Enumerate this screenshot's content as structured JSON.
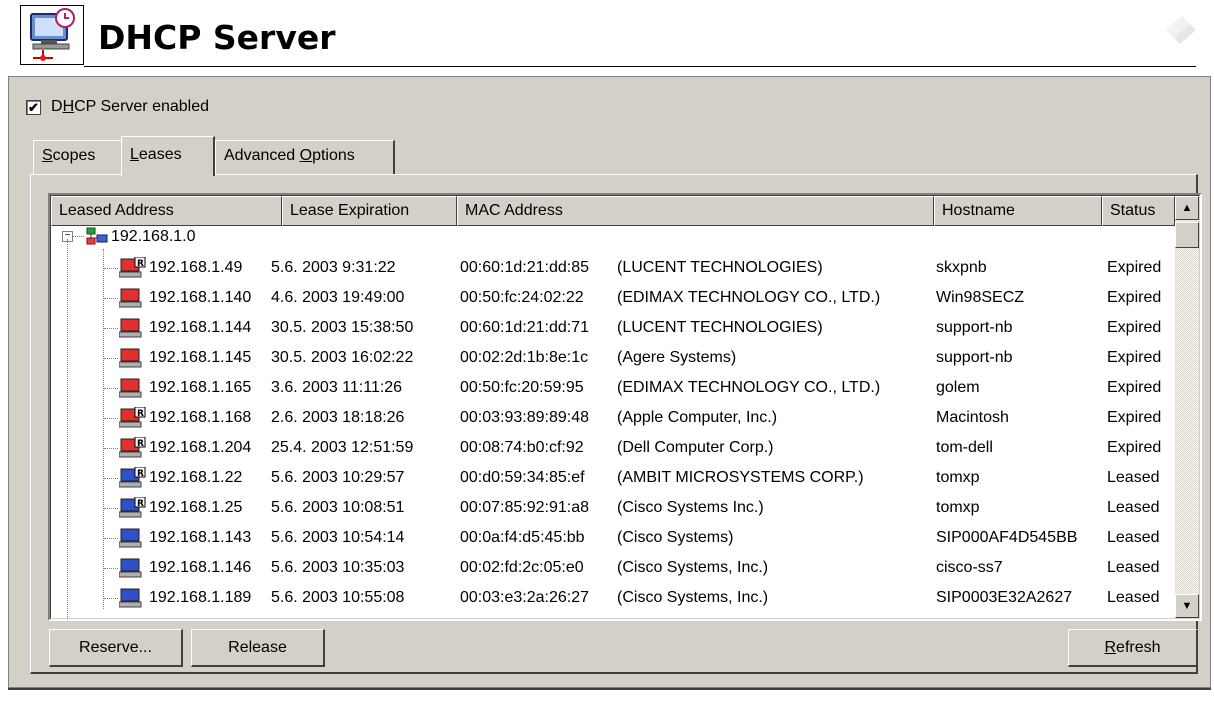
{
  "app": {
    "title": "DHCP Server"
  },
  "enable_checkbox": {
    "label_prefix": "D",
    "label_mnemonic": "H",
    "label_suffix": "CP Server enabled",
    "checked": true
  },
  "tabs": [
    {
      "mnemonic": "S",
      "rest": "copes",
      "active": false
    },
    {
      "mnemonic": "L",
      "rest": "eases",
      "active": true
    },
    {
      "prefix": "Advanced ",
      "mnemonic": "O",
      "rest": "ptions",
      "active": false
    }
  ],
  "columns": [
    "Leased Address",
    "Lease Expiration",
    "MAC Address",
    "Hostname",
    "Status"
  ],
  "scope": {
    "address": "192.168.1.0",
    "icon": "network-scope-icon"
  },
  "leases": [
    {
      "address": "192.168.1.49",
      "expiration": "5.6. 2003 9:31:22",
      "mac": "00:60:1d:21:dd:85",
      "vendor": "(LUCENT TECHNOLOGIES)",
      "hostname": "skxpnb",
      "status": "Expired",
      "reserved": true
    },
    {
      "address": "192.168.1.140",
      "expiration": "4.6. 2003 19:49:00",
      "mac": "00:50:fc:24:02:22",
      "vendor": "(EDIMAX TECHNOLOGY CO., LTD.)",
      "hostname": "Win98SECZ",
      "status": "Expired",
      "reserved": false
    },
    {
      "address": "192.168.1.144",
      "expiration": "30.5. 2003 15:38:50",
      "mac": "00:60:1d:21:dd:71",
      "vendor": "(LUCENT TECHNOLOGIES)",
      "hostname": "support-nb",
      "status": "Expired",
      "reserved": false
    },
    {
      "address": "192.168.1.145",
      "expiration": "30.5. 2003 16:02:22",
      "mac": "00:02:2d:1b:8e:1c",
      "vendor": "(Agere Systems)",
      "hostname": "support-nb",
      "status": "Expired",
      "reserved": false
    },
    {
      "address": "192.168.1.165",
      "expiration": "3.6. 2003 11:11:26",
      "mac": "00:50:fc:20:59:95",
      "vendor": "(EDIMAX TECHNOLOGY CO., LTD.)",
      "hostname": "golem",
      "status": "Expired",
      "reserved": false
    },
    {
      "address": "192.168.1.168",
      "expiration": "2.6. 2003 18:18:26",
      "mac": "00:03:93:89:89:48",
      "vendor": "(Apple Computer, Inc.)",
      "hostname": "Macintosh",
      "status": "Expired",
      "reserved": true
    },
    {
      "address": "192.168.1.204",
      "expiration": "25.4. 2003 12:51:59",
      "mac": "00:08:74:b0:cf:92",
      "vendor": "(Dell Computer Corp.)",
      "hostname": "tom-dell",
      "status": "Expired",
      "reserved": true
    },
    {
      "address": "192.168.1.22",
      "expiration": "5.6. 2003 10:29:57",
      "mac": "00:d0:59:34:85:ef",
      "vendor": "(AMBIT MICROSYSTEMS CORP.)",
      "hostname": "tomxp",
      "status": "Leased",
      "reserved": true
    },
    {
      "address": "192.168.1.25",
      "expiration": "5.6. 2003 10:08:51",
      "mac": "00:07:85:92:91:a8",
      "vendor": "(Cisco Systems Inc.)",
      "hostname": "tomxp",
      "status": "Leased",
      "reserved": true
    },
    {
      "address": "192.168.1.143",
      "expiration": "5.6. 2003 10:54:14",
      "mac": "00:0a:f4:d5:45:bb",
      "vendor": "(Cisco Systems)",
      "hostname": "SIP000AF4D545BB",
      "status": "Leased",
      "reserved": false
    },
    {
      "address": "192.168.1.146",
      "expiration": "5.6. 2003 10:35:03",
      "mac": "00:02:fd:2c:05:e0",
      "vendor": "(Cisco Systems, Inc.)",
      "hostname": "cisco-ss7",
      "status": "Leased",
      "reserved": false
    },
    {
      "address": "192.168.1.189",
      "expiration": "5.6. 2003 10:55:08",
      "mac": "00:03:e3:2a:26:27",
      "vendor": "(Cisco Systems, Inc.)",
      "hostname": "SIP0003E32A2627",
      "status": "Leased",
      "reserved": false
    }
  ],
  "status_colors": {
    "Expired": "#e03030",
    "Leased": "#3050c8"
  },
  "buttons": {
    "reserve": "Reserve...",
    "release": "Release",
    "refresh_mnemonic": "R",
    "refresh_rest": "efresh"
  }
}
